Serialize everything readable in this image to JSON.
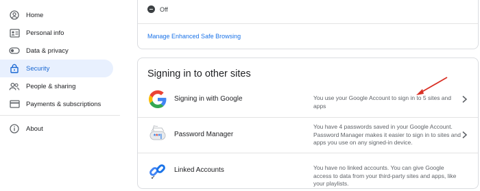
{
  "sidebar": {
    "items": [
      {
        "label": "Home",
        "icon": "person-circle-icon"
      },
      {
        "label": "Personal info",
        "icon": "id-card-icon"
      },
      {
        "label": "Data & privacy",
        "icon": "toggle-icon"
      },
      {
        "label": "Security",
        "icon": "lock-icon",
        "active": true
      },
      {
        "label": "People & sharing",
        "icon": "people-icon"
      },
      {
        "label": "Payments & subscriptions",
        "icon": "credit-card-icon"
      },
      {
        "label": "About",
        "icon": "info-icon"
      }
    ]
  },
  "safe_browsing": {
    "status": "Off",
    "manage_link": "Manage Enhanced Safe Browsing"
  },
  "signin_section": {
    "title": "Signing in to other sites",
    "rows": [
      {
        "name": "Signing in with Google",
        "icon": "google-g-icon",
        "description": "You use your Google Account to sign in to 5 sites and apps"
      },
      {
        "name": "Password Manager",
        "icon": "password-manager-icon",
        "description": "You have 4 passwords saved in your Google Account. Password Manager makes it easier to sign in to sites and apps you use on any signed-in device."
      },
      {
        "name": "Linked Accounts",
        "icon": "linked-accounts-icon",
        "description": "You have no linked accounts. You can give Google access to data from your third-party sites and apps, like your playlists."
      }
    ]
  },
  "colors": {
    "accent": "#1a73e8",
    "active_bg": "#e8f0fe",
    "arrow": "#d93025"
  }
}
